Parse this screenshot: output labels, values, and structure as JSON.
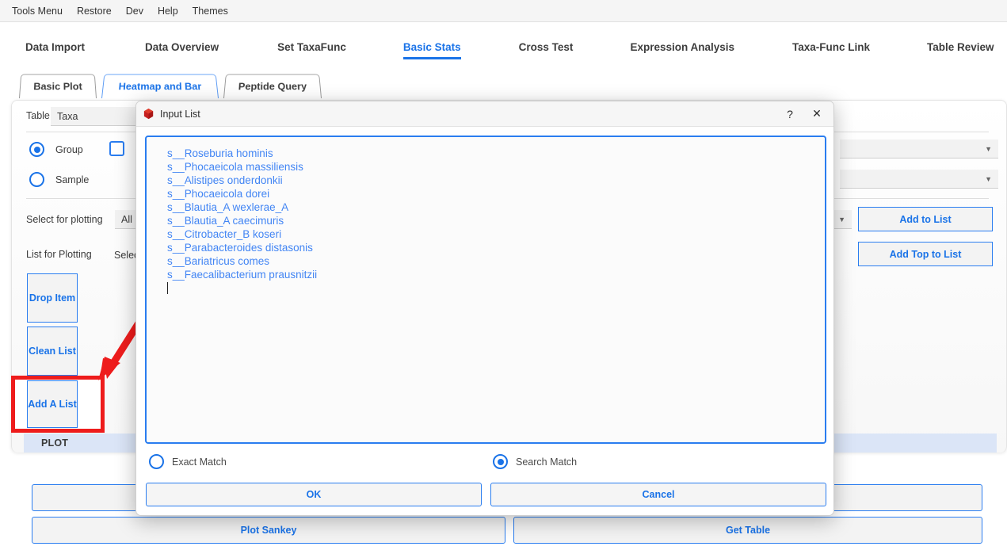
{
  "menubar": {
    "items": [
      "Tools Menu",
      "Restore",
      "Dev",
      "Help",
      "Themes"
    ]
  },
  "mainnav": {
    "tabs": [
      {
        "label": "Data Import",
        "active": false
      },
      {
        "label": "Data Overview",
        "active": false
      },
      {
        "label": "Set TaxaFunc",
        "active": false
      },
      {
        "label": "Basic Stats",
        "active": true
      },
      {
        "label": "Cross Test",
        "active": false
      },
      {
        "label": "Expression Analysis",
        "active": false
      },
      {
        "label": "Taxa-Func Link",
        "active": false
      },
      {
        "label": "Table Review",
        "active": false
      }
    ],
    "active_color": "#1a73e8"
  },
  "subtabs": {
    "tabs": [
      {
        "label": "Basic Plot",
        "active": false
      },
      {
        "label": "Heatmap and Bar",
        "active": true
      },
      {
        "label": "Peptide Query",
        "active": false
      }
    ]
  },
  "panel": {
    "table_label": "Table",
    "table_value": "Taxa",
    "group_label": "Group",
    "sample_label": "Sample",
    "select_for_plotting_label": "Select for plotting",
    "select_for_plotting_value": "All",
    "list_for_plotting_label": "List for Plotting",
    "list_for_plotting_value": "Select T",
    "drop_item_label": "Drop Item",
    "clean_list_label": "Clean List",
    "add_a_list_label": "Add A List",
    "add_to_list_label": "Add to List",
    "add_top_to_list_label": "Add Top to List",
    "plot_bar_label": "PLOT",
    "plot_sankey_label": "Plot  Sankey",
    "get_table_label": "Get Table",
    "caret_glyph": "▼"
  },
  "annotation": {
    "highlight_color": "#ee1c1c",
    "target": "add-a-list-button"
  },
  "dialog": {
    "title": "Input List",
    "icon": "red-hexagon-icon",
    "help_glyph": "?",
    "close_glyph": "✕",
    "items": [
      "s__Roseburia hominis",
      "s__Phocaeicola massiliensis",
      "s__Alistipes onderdonkii",
      "s__Phocaeicola dorei",
      "s__Blautia_A wexlerae_A",
      "s__Blautia_A caecimuris",
      "s__Citrobacter_B koseri",
      "s__Parabacteroides distasonis",
      "s__Bariatricus comes",
      "s__Faecalibacterium prausnitzii"
    ],
    "text_color": "#4285f4",
    "exact_match_label": "Exact Match",
    "exact_match_selected": false,
    "search_match_label": "Search Match",
    "search_match_selected": true,
    "ok_label": "OK",
    "cancel_label": "Cancel"
  }
}
